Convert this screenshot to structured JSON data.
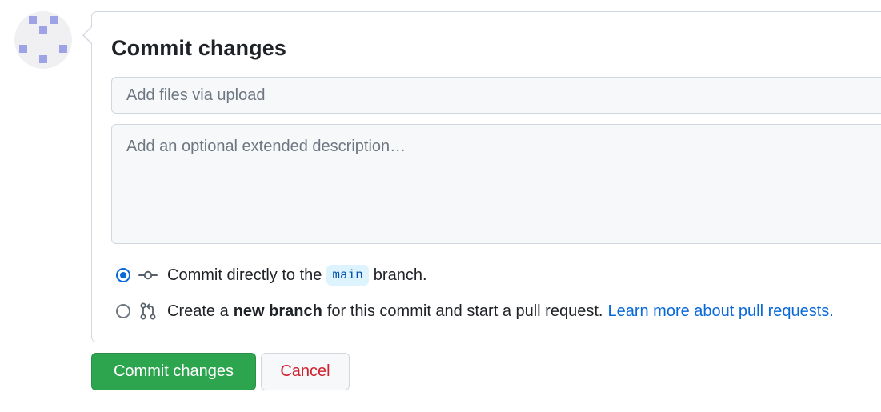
{
  "avatar": {
    "alt": "user identicon"
  },
  "commit_form": {
    "title": "Commit changes",
    "summary_placeholder": "Add files via upload",
    "description_placeholder": "Add an optional extended description…",
    "options": [
      {
        "selected": true,
        "icon": "git-commit-icon",
        "prefix": "Commit directly to the",
        "branch": "main",
        "suffix": "branch."
      },
      {
        "selected": false,
        "icon": "git-pull-request-icon",
        "prefix": "Create a",
        "bold": "new branch",
        "suffix": "for this commit and start a pull request.",
        "link": "Learn more about pull requests."
      }
    ]
  },
  "actions": {
    "commit_label": "Commit changes",
    "cancel_label": "Cancel"
  },
  "colors": {
    "primary_button": "#2da44e",
    "link": "#0969da",
    "cancel_text": "#cf222e",
    "identicon": "#9ea2e6"
  }
}
